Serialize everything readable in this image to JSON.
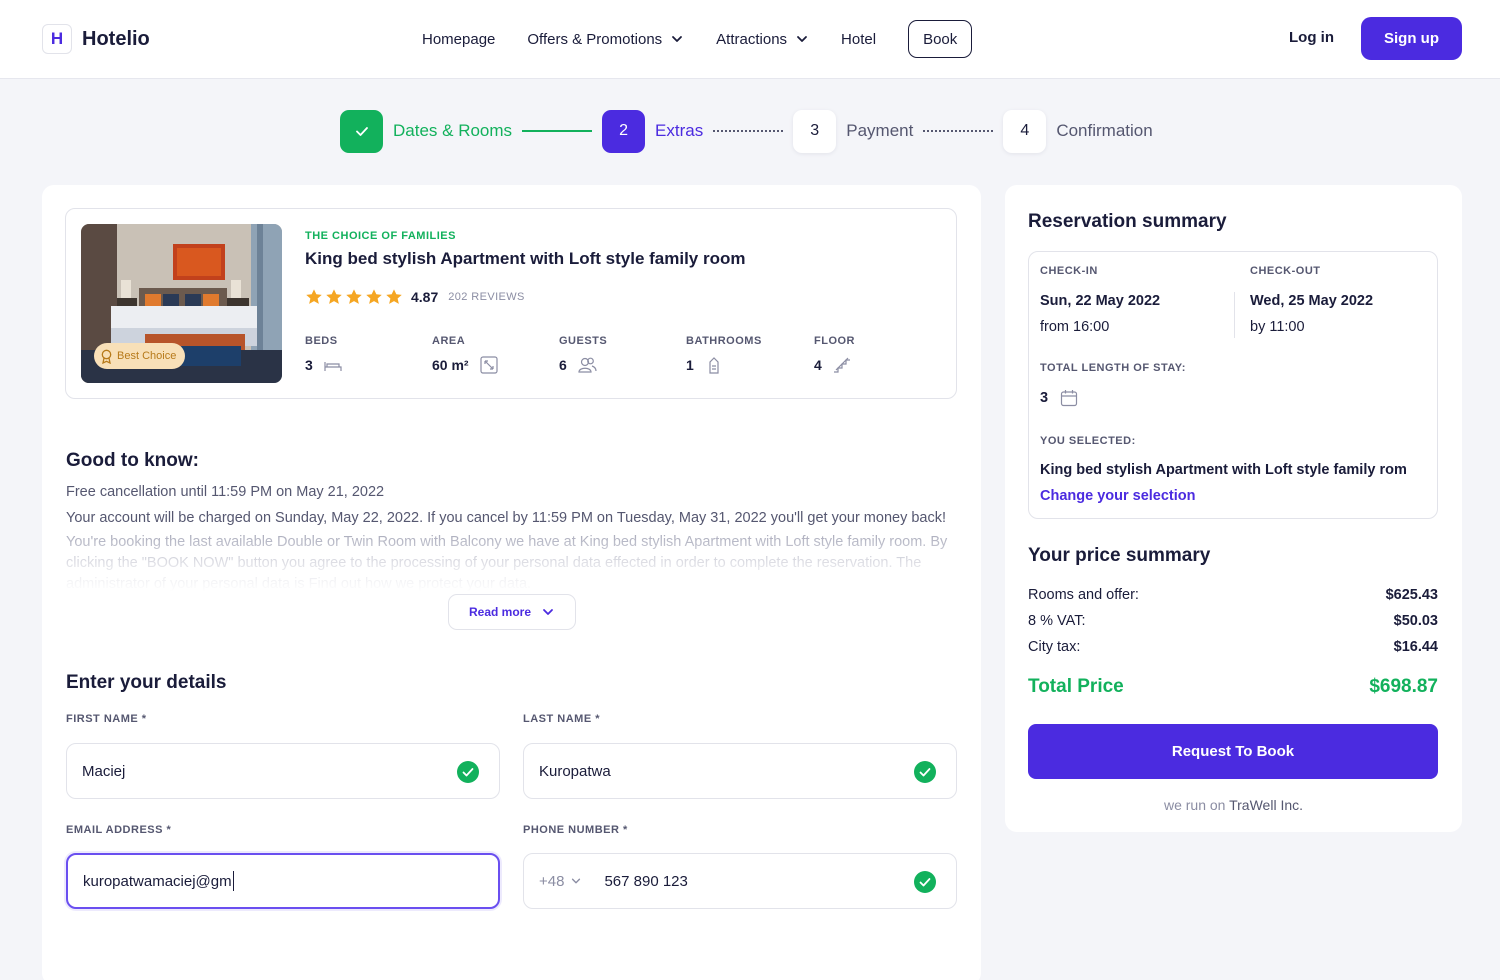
{
  "header": {
    "logo_mark": "H",
    "brand": "Hotelio",
    "nav": [
      {
        "label": "Homepage"
      },
      {
        "label": "Offers & Promotions"
      },
      {
        "label": "Attractions"
      },
      {
        "label": "Hotel"
      }
    ],
    "book_label": "Book",
    "login_label": "Log in",
    "signup_label": "Sign up"
  },
  "stepper": {
    "steps": [
      {
        "number": "",
        "label": "Dates & Rooms"
      },
      {
        "number": "2",
        "label": "Extras"
      },
      {
        "number": "3",
        "label": "Payment"
      },
      {
        "number": "4",
        "label": "Confirmation"
      }
    ]
  },
  "room": {
    "badge": "Best Choice",
    "tag": "THE CHOICE OF FAMILIES",
    "title": "King bed stylish Apartment with Loft style family room",
    "rating": "4.87",
    "reviews": "202 REVIEWS",
    "specs": [
      {
        "label": "BEDS",
        "value": "3",
        "icon": "bed-icon"
      },
      {
        "label": "AREA",
        "value": "60 m²",
        "icon": "area-icon"
      },
      {
        "label": "GUESTS",
        "value": "6",
        "icon": "guests-icon"
      },
      {
        "label": "BATHROOMS",
        "value": "1",
        "icon": "bathroom-icon"
      },
      {
        "label": "FLOOR",
        "value": "4",
        "icon": "stairs-icon"
      }
    ]
  },
  "good_to_know": {
    "title": "Good to know:",
    "line1": "Free cancellation until 11:59 PM on May 21, 2022",
    "line2": "Your account will be charged on Sunday, May 22, 2022. If you cancel by 11:59 PM on Tuesday, May 31, 2022 you'll get your money back!",
    "more": "You're booking the last available Double or Twin Room with Balcony we have at King bed stylish Apartment with Loft style family room. By clicking the \"BOOK NOW\" button you agree to the processing of your personal data effected in order to complete the reservation. The administrator of your personal data is Find out how we protect your data.",
    "read_more": "Read more"
  },
  "details": {
    "title": "Enter your details",
    "first_name_label": "FIRST NAME *",
    "first_name": "Maciej",
    "last_name_label": "LAST NAME *",
    "last_name": "Kuropatwa",
    "email_label": "EMAIL ADDRESS *",
    "email": "kuropatwamaciej@gm",
    "phone_label": "PHONE NUMBER *",
    "phone_prefix": "+48",
    "phone": "567 890 123"
  },
  "summary": {
    "title": "Reservation summary",
    "checkin_label": "CHECK-IN",
    "checkin_date": "Sun, 22 May 2022",
    "checkin_time": "from 16:00",
    "checkout_label": "CHECK-OUT",
    "checkout_date": "Wed, 25 May 2022",
    "checkout_time": "by 11:00",
    "length_label": "TOTAL LENGTH OF STAY:",
    "length": "3",
    "selected_label": "YOU SELECTED:",
    "selected_room": "King bed stylish Apartment with Loft style family rom",
    "change_label": "Change your selection"
  },
  "price": {
    "title": "Your price summary",
    "rows": [
      {
        "label": "Rooms and offer:",
        "amount": "$625.43"
      },
      {
        "label": "8 % VAT:",
        "amount": "$50.03"
      },
      {
        "label": "City tax:",
        "amount": "$16.44"
      }
    ],
    "total_label": "Total Price",
    "total": "$698.87",
    "request_label": "Request To Book",
    "powered_prefix": "we run on",
    "powered_company": "TraWell Inc."
  },
  "colors": {
    "accent": "#4b2be0",
    "success": "#12b15c",
    "text": "#1a1c3a"
  }
}
